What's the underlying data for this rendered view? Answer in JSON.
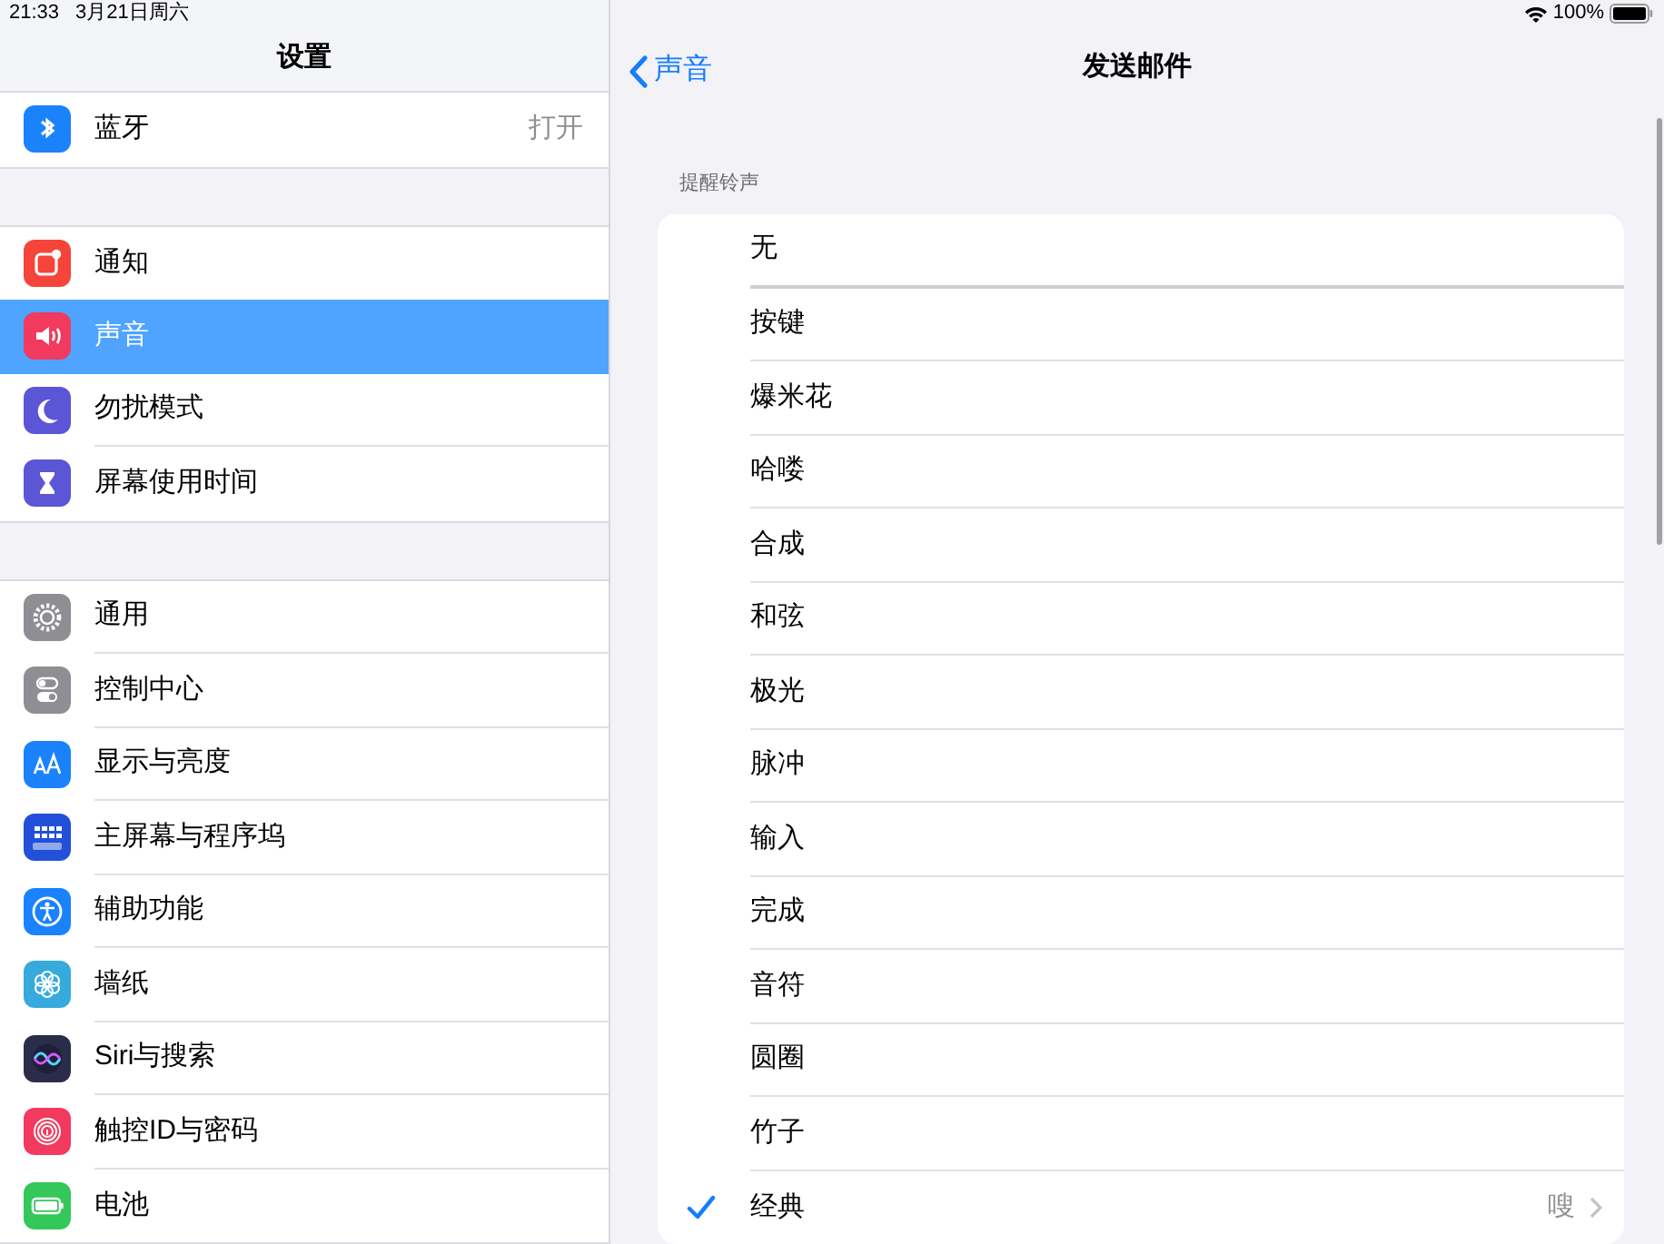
{
  "status_bar": {
    "time": "21:33",
    "date": "3月21日周六",
    "battery": "100%"
  },
  "sidebar": {
    "title": "设置",
    "groups": [
      [
        {
          "label": "蓝牙",
          "value": "打开",
          "selected": false,
          "color": "#1a82fb"
        }
      ],
      [
        {
          "label": "通知",
          "selected": false,
          "color": "#f5443a"
        },
        {
          "label": "声音",
          "selected": true,
          "color": "#f23a5e"
        },
        {
          "label": "勿扰模式",
          "selected": false,
          "color": "#5a56d6"
        },
        {
          "label": "屏幕使用时间",
          "selected": false,
          "color": "#5a56d6"
        }
      ],
      [
        {
          "label": "通用",
          "selected": false,
          "color": "#8e8e93"
        },
        {
          "label": "控制中心",
          "selected": false,
          "color": "#8e8e93"
        },
        {
          "label": "显示与亮度",
          "selected": false,
          "color": "#1a82fb"
        },
        {
          "label": "主屏幕与程序坞",
          "selected": false,
          "color": "#2350d8"
        },
        {
          "label": "辅助功能",
          "selected": false,
          "color": "#1a82fb"
        },
        {
          "label": "墙纸",
          "selected": false,
          "color": "#36aadc"
        },
        {
          "label": "Siri与搜索",
          "selected": false,
          "color": "#2b2b4a"
        },
        {
          "label": "触控ID与密码",
          "selected": false,
          "color": "#f23a5e"
        },
        {
          "label": "电池",
          "selected": false,
          "color": "#34c759"
        }
      ]
    ]
  },
  "detail": {
    "back": "声音",
    "title": "发送邮件",
    "section_header": "提醒铃声",
    "tones": [
      {
        "label": "无",
        "selected": false
      },
      {
        "label": "按键",
        "selected": false
      },
      {
        "label": "爆米花",
        "selected": false
      },
      {
        "label": "哈喽",
        "selected": false
      },
      {
        "label": "合成",
        "selected": false
      },
      {
        "label": "和弦",
        "selected": false
      },
      {
        "label": "极光",
        "selected": false
      },
      {
        "label": "脉冲",
        "selected": false
      },
      {
        "label": "输入",
        "selected": false
      },
      {
        "label": "完成",
        "selected": false
      },
      {
        "label": "音符",
        "selected": false
      },
      {
        "label": "圆圈",
        "selected": false
      },
      {
        "label": "竹子",
        "selected": false
      },
      {
        "label": "经典",
        "selected": true,
        "detail": "嗖"
      }
    ]
  }
}
